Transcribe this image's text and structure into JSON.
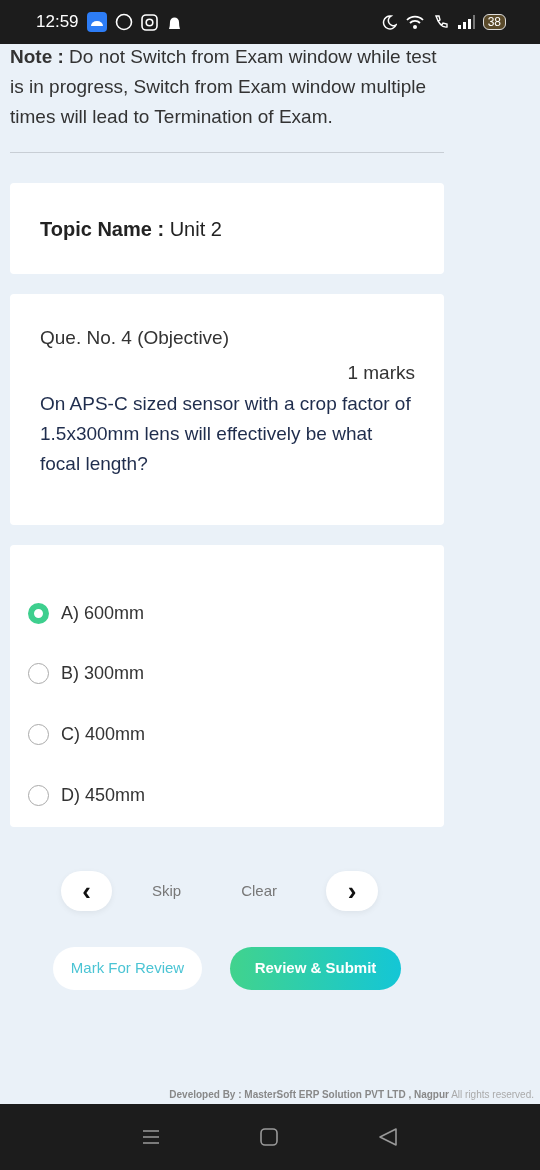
{
  "status_bar": {
    "time": "12:59",
    "battery": "38"
  },
  "note": "**Note :** Do not Switch from Exam window while test is in progress, Switch from Exam window multiple times will lead to Termination of Exam.",
  "topic": {
    "label": "Topic Name :",
    "value": "Unit 2"
  },
  "question": {
    "number": "Que. No. 4 (Objective)",
    "marks": "1 marks",
    "text": "On APS-C sized sensor with a crop factor of 1.5x300mm lens will effectively be what focal length?"
  },
  "options": [
    {
      "label": "A) 600mm",
      "selected": true
    },
    {
      "label": "B) 300mm",
      "selected": false
    },
    {
      "label": "C) 400mm",
      "selected": false
    },
    {
      "label": "D) 450mm",
      "selected": false
    }
  ],
  "nav": {
    "prev": "‹",
    "skip": "Skip",
    "clear": "Clear",
    "next": "›"
  },
  "actions": {
    "mark": "Mark For Review",
    "submit": "Review & Submit"
  },
  "footer": "**Developed By : MasterSoft ERP Solution PVT LTD , Nagpur** All rights reserved."
}
